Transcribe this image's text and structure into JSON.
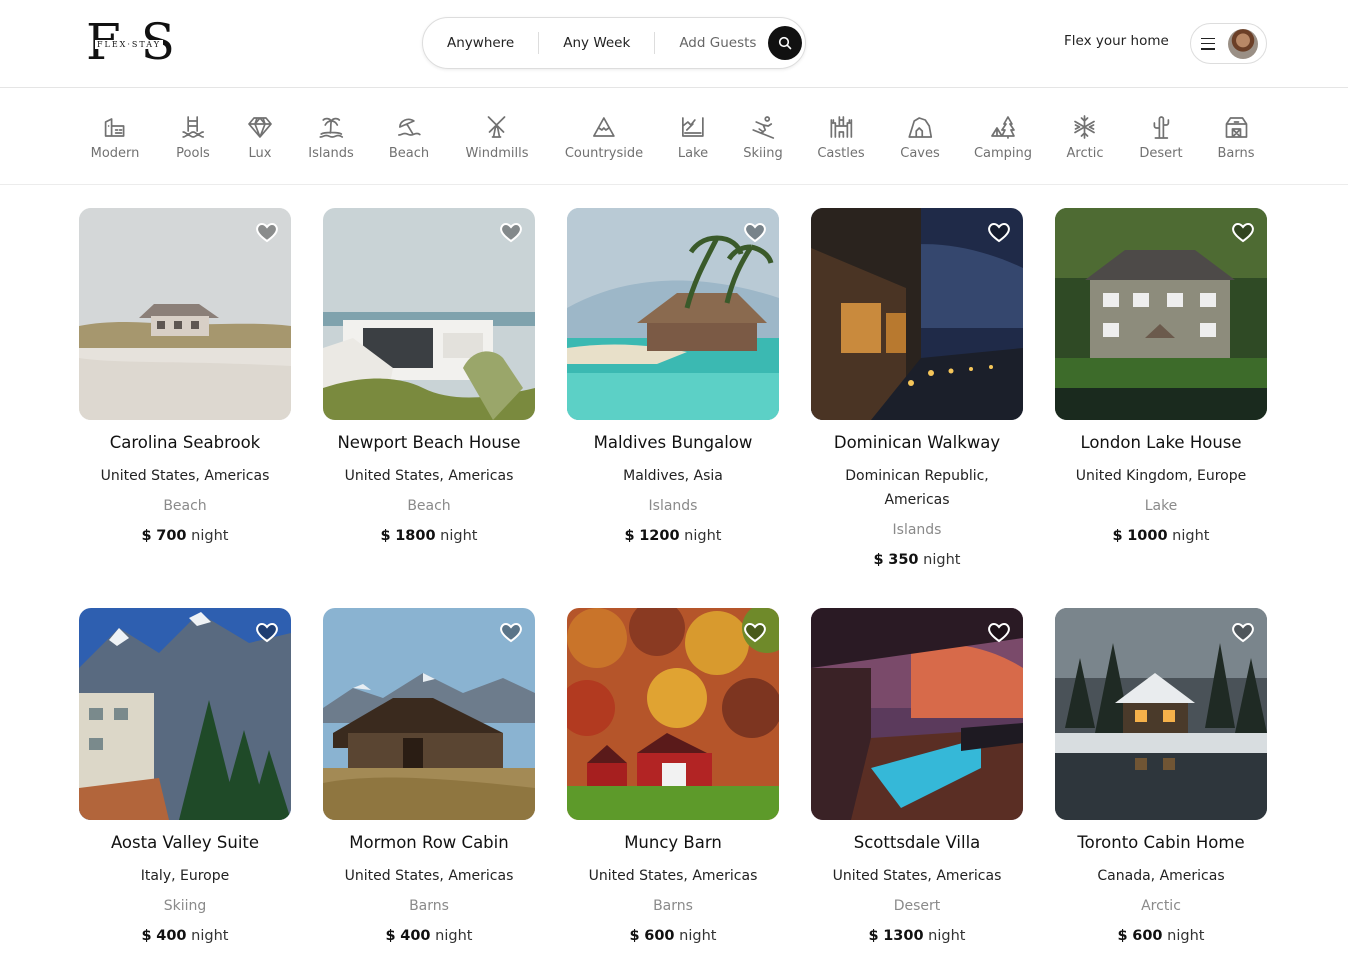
{
  "brand": {
    "letters": "FS",
    "subtitle": "FLEX·STAY"
  },
  "search": {
    "where": "Anywhere",
    "when": "Any Week",
    "who": "Add Guests",
    "button_icon": "search-icon"
  },
  "host_link": "Flex your home",
  "user_menu": {
    "icon": "hamburger-menu-icon",
    "avatar": "user-avatar"
  },
  "categories": [
    {
      "label": "Modern",
      "icon": "modern-building-icon"
    },
    {
      "label": "Pools",
      "icon": "pool-icon"
    },
    {
      "label": "Lux",
      "icon": "diamond-icon"
    },
    {
      "label": "Islands",
      "icon": "island-icon"
    },
    {
      "label": "Beach",
      "icon": "beach-umbrella-icon"
    },
    {
      "label": "Windmills",
      "icon": "windmill-icon"
    },
    {
      "label": "Countryside",
      "icon": "mountain-icon"
    },
    {
      "label": "Lake",
      "icon": "lake-icon"
    },
    {
      "label": "Skiing",
      "icon": "skiing-icon"
    },
    {
      "label": "Castles",
      "icon": "castle-icon"
    },
    {
      "label": "Caves",
      "icon": "cave-icon"
    },
    {
      "label": "Camping",
      "icon": "tent-icon"
    },
    {
      "label": "Arctic",
      "icon": "snowflake-icon"
    },
    {
      "label": "Desert",
      "icon": "cactus-icon"
    },
    {
      "label": "Barns",
      "icon": "barn-icon"
    }
  ],
  "listings": [
    {
      "title": "Carolina Seabrook",
      "location": "United States, Americas",
      "category": "Beach",
      "currency": "$",
      "price": "700",
      "unit": "night"
    },
    {
      "title": "Newport Beach House",
      "location": "United States, Americas",
      "category": "Beach",
      "currency": "$",
      "price": "1800",
      "unit": "night"
    },
    {
      "title": "Maldives Bungalow",
      "location": "Maldives, Asia",
      "category": "Islands",
      "currency": "$",
      "price": "1200",
      "unit": "night"
    },
    {
      "title": "Dominican Walkway",
      "location": "Dominican Republic, Americas",
      "category": "Islands",
      "currency": "$",
      "price": "350",
      "unit": "night"
    },
    {
      "title": "London Lake House",
      "location": "United Kingdom, Europe",
      "category": "Lake",
      "currency": "$",
      "price": "1000",
      "unit": "night"
    },
    {
      "title": "Aosta Valley Suite",
      "location": "Italy, Europe",
      "category": "Skiing",
      "currency": "$",
      "price": "400",
      "unit": "night"
    },
    {
      "title": "Mormon Row Cabin",
      "location": "United States, Americas",
      "category": "Barns",
      "currency": "$",
      "price": "400",
      "unit": "night"
    },
    {
      "title": "Muncy Barn",
      "location": "United States, Americas",
      "category": "Barns",
      "currency": "$",
      "price": "600",
      "unit": "night"
    },
    {
      "title": "Scottsdale Villa",
      "location": "United States, Americas",
      "category": "Desert",
      "currency": "$",
      "price": "1300",
      "unit": "night"
    },
    {
      "title": "Toronto Cabin Home",
      "location": "Canada, Americas",
      "category": "Arctic",
      "currency": "$",
      "price": "600",
      "unit": "night"
    }
  ]
}
